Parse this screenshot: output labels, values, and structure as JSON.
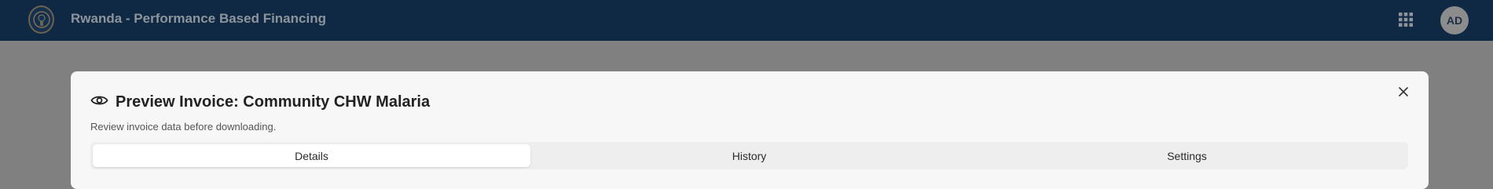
{
  "header": {
    "app_title": "Rwanda - Performance Based Financing",
    "logo_icon": "rwanda-coat-of-arms",
    "apps_icon": "grid-icon",
    "avatar_initials": "AD",
    "background_color": "#0f2945"
  },
  "modal": {
    "title": "Preview Invoice: Community CHW Malaria",
    "title_icon": "eye-icon",
    "description": "Review invoice data before downloading.",
    "close_icon": "close-icon",
    "tabs": [
      {
        "label": "Details",
        "active": true
      },
      {
        "label": "History",
        "active": false
      },
      {
        "label": "Settings",
        "active": false
      }
    ]
  }
}
